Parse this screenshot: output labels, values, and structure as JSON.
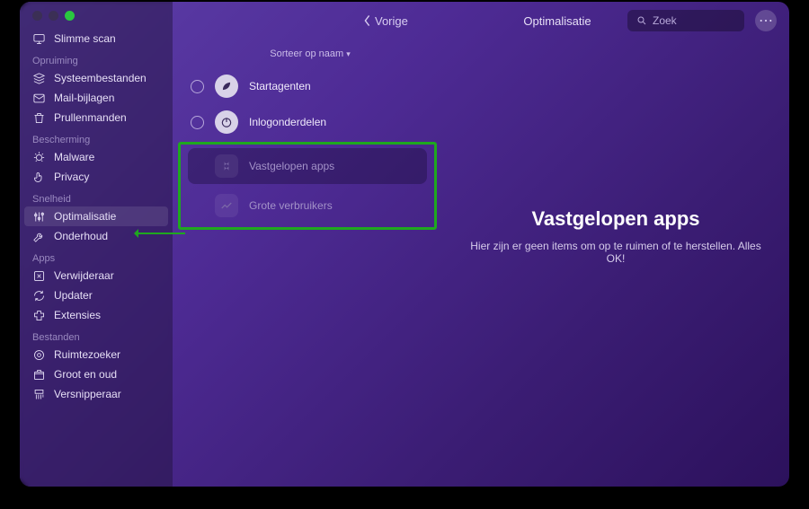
{
  "topbar": {
    "back_label": "Vorige",
    "title": "Optimalisatie",
    "search_placeholder": "Zoek"
  },
  "sidebar": {
    "smart_scan": "Slimme scan",
    "sections": [
      {
        "title": "Opruiming",
        "items": [
          {
            "label": "Systeembestanden",
            "icon": "stack"
          },
          {
            "label": "Mail-bijlagen",
            "icon": "mail"
          },
          {
            "label": "Prullenmanden",
            "icon": "trash"
          }
        ]
      },
      {
        "title": "Bescherming",
        "items": [
          {
            "label": "Malware",
            "icon": "bug"
          },
          {
            "label": "Privacy",
            "icon": "hand"
          }
        ]
      },
      {
        "title": "Snelheid",
        "items": [
          {
            "label": "Optimalisatie",
            "icon": "sliders",
            "active": true
          },
          {
            "label": "Onderhoud",
            "icon": "wrench"
          }
        ]
      },
      {
        "title": "Apps",
        "items": [
          {
            "label": "Verwijderaar",
            "icon": "uninstall"
          },
          {
            "label": "Updater",
            "icon": "update"
          },
          {
            "label": "Extensies",
            "icon": "extension"
          }
        ]
      },
      {
        "title": "Bestanden",
        "items": [
          {
            "label": "Ruimtezoeker",
            "icon": "lens"
          },
          {
            "label": "Groot en oud",
            "icon": "box"
          },
          {
            "label": "Versnipperaar",
            "icon": "shred"
          }
        ]
      }
    ]
  },
  "list": {
    "sort_label": "Sorteer op naam",
    "items": [
      {
        "label": "Startagenten",
        "icon": "rocket",
        "selectable": true
      },
      {
        "label": "Inlogonderdelen",
        "icon": "power",
        "selectable": true
      },
      {
        "label": "Vastgelopen apps",
        "icon": "hourglass",
        "selectable": false,
        "active": true
      },
      {
        "label": "Grote verbruikers",
        "icon": "chart",
        "selectable": false
      }
    ]
  },
  "detail": {
    "title": "Vastgelopen apps",
    "subtitle": "Hier zijn er geen items om op te ruimen of te herstellen. Alles OK!"
  }
}
